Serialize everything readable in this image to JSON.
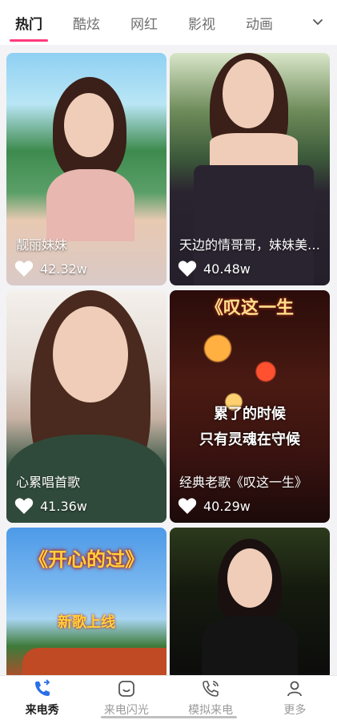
{
  "tabs": [
    {
      "label": "热门",
      "active": true
    },
    {
      "label": "酷炫",
      "active": false
    },
    {
      "label": "网红",
      "active": false
    },
    {
      "label": "影视",
      "active": false
    },
    {
      "label": "动画",
      "active": false
    }
  ],
  "cards": [
    {
      "caption": "靓丽妹妹",
      "likes": "42.32w"
    },
    {
      "caption": "天边的情哥哥，妹妹美…",
      "likes": "40.48w"
    },
    {
      "caption": "心累唱首歌",
      "likes": "41.36w"
    },
    {
      "caption": "经典老歌《叹这一生》",
      "likes": "40.29w",
      "overlay_title": "《叹这一生",
      "overlay_line1": "累了的时候",
      "overlay_line2": "只有灵魂在守候"
    },
    {
      "overlay_title": "《开心的过》",
      "overlay_sub": "新歌上线"
    },
    {}
  ],
  "bottom_nav": [
    {
      "label": "来电秀",
      "active": true
    },
    {
      "label": "来电闪光",
      "active": false
    },
    {
      "label": "模拟来电",
      "active": false
    },
    {
      "label": "更多",
      "active": false
    }
  ],
  "colors": {
    "accent": "#ff3b7e",
    "active_icon": "#2a6fe8"
  }
}
